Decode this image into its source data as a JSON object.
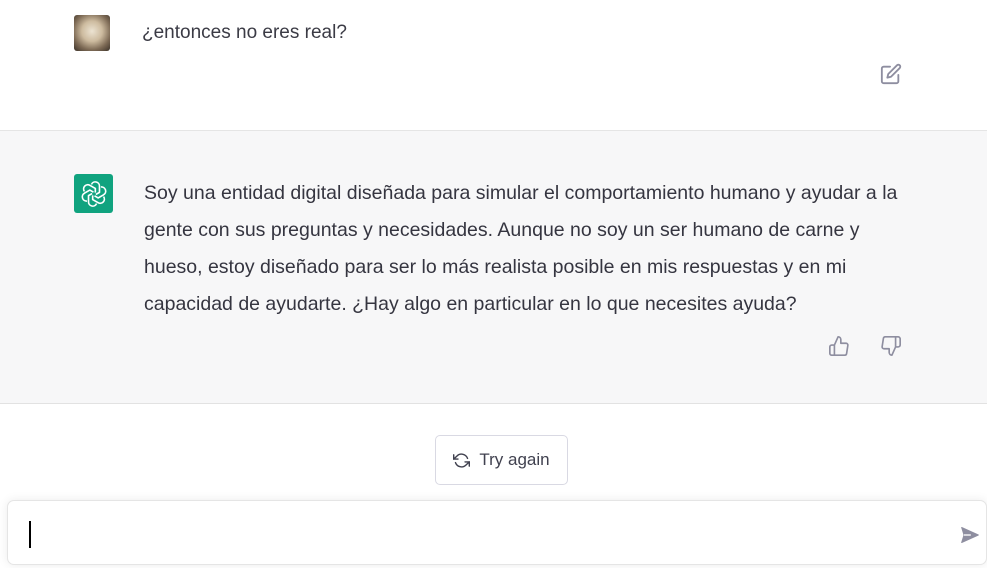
{
  "user_message": {
    "avatar_icon": "user-avatar-photo",
    "text": "¿entonces no eres real?",
    "edit_icon": "edit-icon"
  },
  "assistant_message": {
    "avatar_icon": "openai-logo-icon",
    "avatar_color": "#10a37f",
    "text": "Soy una entidad digital diseñada para simular el comportamiento humano y ayudar a la gente con sus preguntas y necesidades. Aunque no soy un ser humano de carne y hueso, estoy diseñado para ser lo más realista posible en mis respuestas y en mi capacidad de ayudarte. ¿Hay algo en particular en lo que necesites ayuda?",
    "feedback_icons": [
      "thumbs-up-icon",
      "thumbs-down-icon"
    ]
  },
  "controls": {
    "try_again_label": "Try again",
    "try_again_icon": "refresh-icon"
  },
  "composer": {
    "value": "",
    "placeholder": "",
    "send_icon": "send-icon"
  },
  "colors": {
    "assistant_background": "#f7f7f8",
    "user_background": "#ffffff"
  }
}
